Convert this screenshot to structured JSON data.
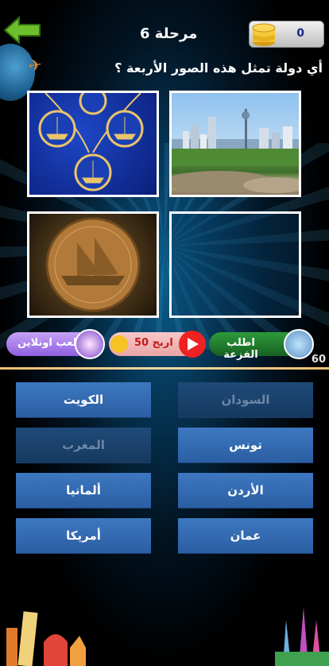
{
  "header": {
    "back_icon": "back-arrow-icon",
    "level_label": "مرحلة  6",
    "coins": {
      "icon": "coin-stack-icon",
      "count": "0"
    }
  },
  "question": "أي دولة تمثل هذه الصور الأربعة ؟",
  "images": [
    {
      "name": "necklace-dhow-pendants",
      "desc_icon": "jewelry-icon"
    },
    {
      "name": "city-skyline-tower",
      "desc_icon": "skyline-icon"
    },
    {
      "name": "dhow-coin",
      "desc_icon": "coin-icon"
    },
    {
      "name": "empty-frame",
      "desc_icon": ""
    }
  ],
  "actions": {
    "help_label": "اطلب الفزعة",
    "earn_label": "اربح 50",
    "online_label": "العب اونلاين"
  },
  "hints_count": "60",
  "answers": [
    {
      "label": "السودان",
      "disabled": true
    },
    {
      "label": "الكويت",
      "disabled": false
    },
    {
      "label": "تونس",
      "disabled": false
    },
    {
      "label": "المغرب",
      "disabled": true
    },
    {
      "label": "الأردن",
      "disabled": false
    },
    {
      "label": "ألمانيا",
      "disabled": false
    },
    {
      "label": "عمان",
      "disabled": false
    },
    {
      "label": "أمريكا",
      "disabled": false
    }
  ],
  "colors": {
    "answer_bg": "#2f66ad",
    "answer_disabled_bg": "#1e4a78",
    "divider": "#f0c070",
    "back_arrow": "#6cbf2a"
  }
}
